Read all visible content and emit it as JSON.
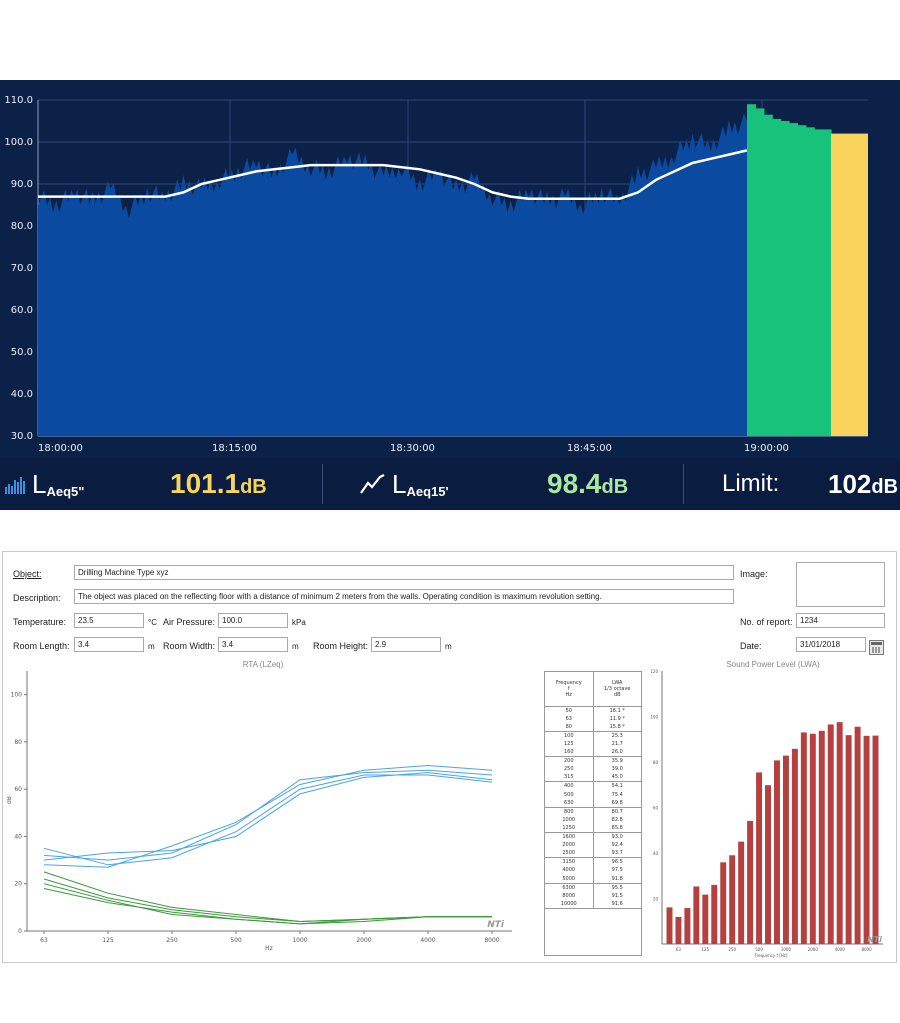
{
  "monitor": {
    "y_ticks": [
      "110.0",
      "100.0",
      "90.0",
      "80.0",
      "70.0",
      "60.0",
      "50.0",
      "40.0",
      "30.0"
    ],
    "x_ticks": [
      "18:00:00",
      "18:15:00",
      "18:30:00",
      "18:45:00",
      "19:00:00"
    ],
    "colors": {
      "background": "#0c2148",
      "fill": "#0a4aa0",
      "trend": "#ffffff",
      "current_bar": "#17c27a",
      "limit_bar": "#f8d45c"
    },
    "readout": {
      "m1_symbol": "L",
      "m1_sub": "Aeq5\"",
      "m1_value": "101.1",
      "m1_unit": "dB",
      "m2_symbol": "L",
      "m2_sub": "Aeq15'",
      "m2_value": "98.4",
      "m2_unit": "dB",
      "limit_label": "Limit:",
      "limit_value": "102",
      "limit_unit": "dB",
      "m1_icon": "bar-spectrum-icon",
      "m2_icon": "trend-line-icon",
      "m1_color": "#f8d45c",
      "m2_color": "#a8e8a0"
    }
  },
  "chart_data": [
    {
      "type": "area",
      "ylim": [
        30,
        110
      ],
      "x": [
        "18:00:00",
        "18:15:00",
        "18:30:00",
        "18:45:00",
        "19:00:00"
      ],
      "series": [
        {
          "values": [
            87,
            87,
            87,
            87,
            87,
            87,
            87,
            87,
            88,
            90,
            91,
            92,
            93,
            93.5,
            94,
            94.5,
            94.5,
            94.5,
            94.5,
            94.5,
            94,
            93.5,
            92.5,
            91.5,
            90,
            88,
            87,
            86.5,
            86.5,
            86.5,
            86.5,
            86.5,
            86.5,
            88,
            91,
            93,
            95,
            96,
            97,
            98
          ]
        },
        {
          "values": [
            87,
            85,
            88,
            86,
            89,
            84,
            88,
            87,
            90,
            89,
            91,
            93,
            95,
            92,
            97,
            94,
            93,
            96,
            95,
            92,
            94,
            90,
            93,
            89,
            91,
            87,
            85,
            88,
            86,
            87,
            85,
            88,
            86,
            92,
            94,
            97,
            101,
            99,
            103,
            105
          ]
        }
      ]
    },
    {
      "type": "line",
      "title": "RTA (LZeq)",
      "xlabel": "Hz",
      "ylabel": "dB",
      "ylim": [
        0,
        110
      ],
      "categories": [
        "63",
        "125",
        "250",
        "500",
        "1000",
        "2000",
        "4000",
        "8000"
      ],
      "series": [
        {
          "values": [
            32,
            30,
            33,
            45,
            64,
            67,
            68,
            66
          ]
        },
        {
          "values": [
            35,
            28,
            31,
            42,
            60,
            66,
            66,
            63
          ]
        },
        {
          "values": [
            28,
            27,
            36,
            46,
            62,
            68,
            70,
            68
          ]
        },
        {
          "values": [
            30,
            33,
            34,
            40,
            58,
            65,
            67,
            64
          ]
        },
        {
          "values": [
            22,
            14,
            9,
            6,
            4,
            5,
            6,
            6
          ]
        },
        {
          "values": [
            18,
            12,
            8,
            5,
            3,
            5,
            6,
            6
          ]
        },
        {
          "values": [
            25,
            16,
            10,
            7,
            4,
            5,
            6,
            6
          ]
        },
        {
          "values": [
            20,
            13,
            7,
            5,
            3,
            4,
            6,
            6
          ]
        }
      ]
    },
    {
      "type": "bar",
      "title": "Sound Power Level (LWA)",
      "xlabel": "Frequency f [Hz]",
      "ylim": [
        0,
        120
      ],
      "categories": [
        "50",
        "63",
        "80",
        "100",
        "125",
        "160",
        "200",
        "250",
        "315",
        "400",
        "500",
        "630",
        "800",
        "1000",
        "1250",
        "1600",
        "2000",
        "2500",
        "3150",
        "4000",
        "5000",
        "6300",
        "8000",
        "10000"
      ],
      "series": [
        {
          "values": [
            16.1,
            11.9,
            15.8,
            25.3,
            21.7,
            26.0,
            35.9,
            39.0,
            45.0,
            54.1,
            75.4,
            69.8,
            80.7,
            82.8,
            85.8,
            93.0,
            92.4,
            93.7,
            96.5,
            97.5,
            91.8,
            95.5,
            91.5,
            91.6
          ]
        }
      ]
    }
  ],
  "report": {
    "object_label": "Object:",
    "object_value": "Drilling Machine Type xyz",
    "description_label": "Description:",
    "description_value": "The object was placed on the reflecting floor with a distance of minimum 2 meters from the walls. Operating condition is maximum revolution setting.",
    "temperature_label": "Temperature:",
    "temperature_value": "23.5",
    "temperature_unit": "°C",
    "air_pressure_label": "Air Pressure:",
    "air_pressure_value": "100.0",
    "air_pressure_unit": "kPa",
    "room_length_label": "Room Length:",
    "room_length_value": "3.4",
    "room_length_unit": "m",
    "room_width_label": "Room Width:",
    "room_width_value": "3.4",
    "room_width_unit": "m",
    "room_height_label": "Room Height:",
    "room_height_value": "2.9",
    "room_height_unit": "m",
    "image_label": "Image:",
    "report_no_label": "No. of report:",
    "report_no_value": "1234",
    "date_label": "Date:",
    "date_value": "31/01/2018",
    "rta_title": "RTA (LZeq)",
    "rta_xlabel": "Hz",
    "rta_ylabel": "dB",
    "rta_yticks": [
      "100",
      "80",
      "60",
      "40",
      "20",
      "0"
    ],
    "rta_xticks": [
      "63",
      "125",
      "250",
      "500",
      "1000",
      "2000",
      "4000",
      "8000"
    ],
    "rta_logo": "NTi",
    "swl_title": "Sound Power Level (LWA)",
    "swl_xlabel": "Frequency f [Hz]",
    "swl_yticks": [
      "120",
      "100",
      "80",
      "60",
      "40",
      "20"
    ],
    "swl_xticks": [
      "63",
      "125",
      "250",
      "500",
      "1000",
      "2000",
      "4000",
      "8000"
    ],
    "swl_logo": "NTi",
    "table_h1": [
      "Frequency",
      "f",
      "Hz"
    ],
    "table_h2": [
      "LWA",
      "1/3 octave",
      "dB"
    ],
    "table_rows": [
      [
        "50",
        "16.1 *"
      ],
      [
        "63",
        "11.9 *"
      ],
      [
        "80",
        "15.8 *"
      ],
      [
        "100",
        "25.3"
      ],
      [
        "125",
        "21.7"
      ],
      [
        "160",
        "26.0"
      ],
      [
        "200",
        "35.9"
      ],
      [
        "250",
        "39.0"
      ],
      [
        "315",
        "45.0"
      ],
      [
        "400",
        "54.1"
      ],
      [
        "500",
        "75.4"
      ],
      [
        "630",
        "69.8"
      ],
      [
        "800",
        "80.7"
      ],
      [
        "1000",
        "82.8"
      ],
      [
        "1250",
        "85.8"
      ],
      [
        "1600",
        "93.0"
      ],
      [
        "2000",
        "92.4"
      ],
      [
        "2500",
        "93.7"
      ],
      [
        "3150",
        "96.5"
      ],
      [
        "4000",
        "97.5"
      ],
      [
        "5000",
        "91.8"
      ],
      [
        "6300",
        "95.5"
      ],
      [
        "8000",
        "91.5"
      ],
      [
        "10000",
        "91.6"
      ]
    ]
  }
}
